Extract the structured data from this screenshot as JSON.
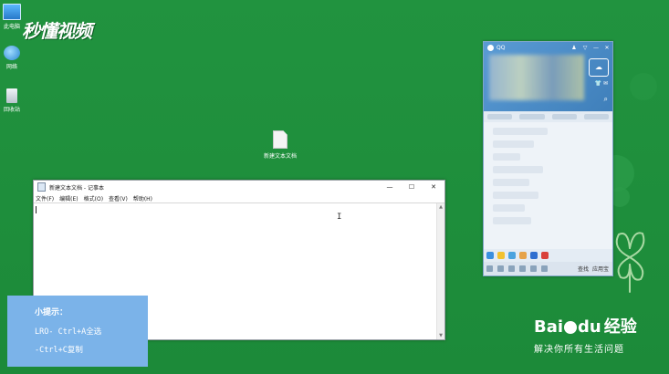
{
  "brand": {
    "text": "秒懂视频"
  },
  "desktop_icons": [
    {
      "label": "此电脑"
    },
    {
      "label": "网络"
    },
    {
      "label": "回收站"
    }
  ],
  "desktop_file": {
    "label": "新建文本文档"
  },
  "notepad": {
    "title": "新建文本文档 - 记事本",
    "menus": [
      "文件(F)",
      "编辑(E)",
      "格式(O)",
      "查看(V)",
      "帮助(H)"
    ],
    "controls": {
      "minimize": "—",
      "maximize": "☐",
      "close": "✕"
    }
  },
  "qq": {
    "title": "QQ",
    "controls": {
      "skin": "♟",
      "menu": "▽",
      "minimize": "—",
      "close": "✕"
    },
    "find_label": "查找",
    "apps_label": "应用宝"
  },
  "tip": {
    "title": "小提示：",
    "line1": "LRO- Ctrl+A全选",
    "line2": "-Ctrl+C复制"
  },
  "baidu": {
    "logo_left": "Bai",
    "logo_right": "du",
    "jingyan": "经验",
    "slogan": "解决你所有生活问题"
  }
}
